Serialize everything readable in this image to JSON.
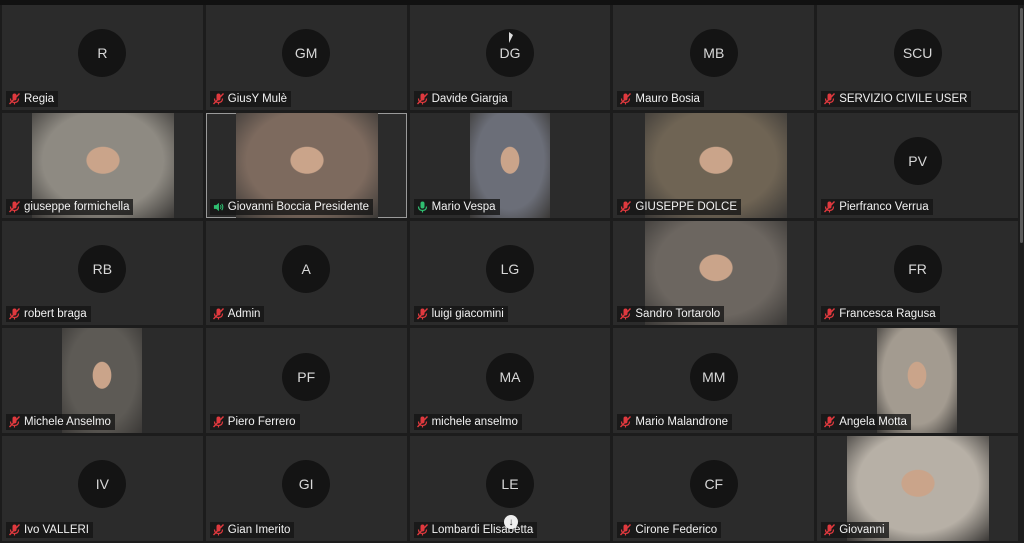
{
  "participants": [
    {
      "name": "Regia",
      "initials": "R",
      "mic": "muted",
      "video": false
    },
    {
      "name": "GiusY Mulè",
      "initials": "GM",
      "mic": "muted",
      "video": false
    },
    {
      "name": "Davide Giargia",
      "initials": "DG",
      "mic": "muted",
      "video": false
    },
    {
      "name": "Mauro Bosia",
      "initials": "MB",
      "mic": "muted",
      "video": false
    },
    {
      "name": "SERVIZIO CIVILE USER",
      "initials": "SCU",
      "mic": "muted",
      "video": false
    },
    {
      "name": "giuseppe formichella",
      "initials": "",
      "mic": "muted",
      "video": true,
      "video_tone": "#8e8a82"
    },
    {
      "name": "Giovanni Boccia Presidente",
      "initials": "",
      "mic": "speaking",
      "video": true,
      "video_tone": "#7d6a5e",
      "active": true
    },
    {
      "name": "Mario Vespa",
      "initials": "",
      "mic": "on",
      "video": true,
      "video_tone": "#6b6e78"
    },
    {
      "name": "GIUSEPPE DOLCE",
      "initials": "",
      "mic": "muted",
      "video": true,
      "video_tone": "#6f6454"
    },
    {
      "name": "Pierfranco Verrua",
      "initials": "PV",
      "mic": "muted",
      "video": false
    },
    {
      "name": "robert braga",
      "initials": "RB",
      "mic": "muted",
      "video": false
    },
    {
      "name": "Admin",
      "initials": "A",
      "mic": "muted",
      "video": false
    },
    {
      "name": "luigi giacomini",
      "initials": "LG",
      "mic": "muted",
      "video": false
    },
    {
      "name": "Sandro Tortarolo",
      "initials": "",
      "mic": "muted",
      "video": true,
      "video_tone": "#6c6660"
    },
    {
      "name": "Francesca Ragusa",
      "initials": "FR",
      "mic": "muted",
      "video": false
    },
    {
      "name": "Michele Anselmo",
      "initials": "",
      "mic": "muted",
      "video": true,
      "video_tone": "#5d5a55"
    },
    {
      "name": "Piero Ferrero",
      "initials": "PF",
      "mic": "muted",
      "video": false
    },
    {
      "name": "michele anselmo",
      "initials": "MA",
      "mic": "muted",
      "video": false
    },
    {
      "name": "Mario Malandrone",
      "initials": "MM",
      "mic": "muted",
      "video": false
    },
    {
      "name": "Angela Motta",
      "initials": "",
      "mic": "muted",
      "video": true,
      "video_tone": "#a39b90"
    },
    {
      "name": "Ivo VALLERI",
      "initials": "IV",
      "mic": "muted",
      "video": false
    },
    {
      "name": "Gian Imerito",
      "initials": "GI",
      "mic": "muted",
      "video": false
    },
    {
      "name": "Lombardi Elisabetta",
      "initials": "LE",
      "mic": "muted",
      "video": false
    },
    {
      "name": "Cirone Federico",
      "initials": "CF",
      "mic": "muted",
      "video": false
    },
    {
      "name": "Giovanni",
      "initials": "",
      "mic": "muted",
      "video": true,
      "video_tone": "#b7b0a6"
    }
  ],
  "colors": {
    "muted_icon": "#e0393e",
    "on_icon": "#2fbf71",
    "tile_bg": "#2b2b2b",
    "avatar_bg": "#141414"
  }
}
